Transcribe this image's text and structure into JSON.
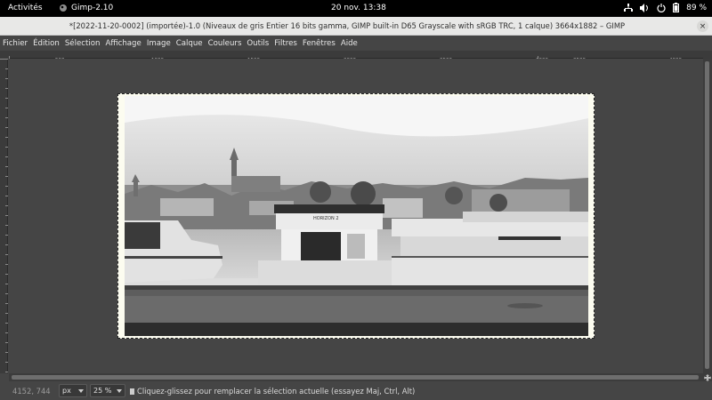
{
  "topbar": {
    "activities": "Activités",
    "app_name": "Gimp-2.10",
    "clock": "20 nov.  13:38",
    "battery": "89 %"
  },
  "window": {
    "title": "*[2022-11-20-0002] (importée)-1.0 (Niveaux de gris Entier 16 bits gamma, GIMP built-in D65 Grayscale with sRGB TRC, 1 calque) 3664x1882 – GIMP",
    "close_glyph": "×"
  },
  "menu": [
    "Fichier",
    "Édition",
    "Sélection",
    "Affichage",
    "Image",
    "Calque",
    "Couleurs",
    "Outils",
    "Filtres",
    "Fenêtres",
    "Aide"
  ],
  "ruler": {
    "labels": [
      "500",
      "1000",
      "1500",
      "2000",
      "2500",
      "3000",
      "3500",
      "4000"
    ]
  },
  "status": {
    "coords": "4152, 744",
    "unit": "px",
    "zoom": "25 %",
    "message": "Cliquez-glissez pour remplacer la sélection actuelle (essayez Maj, Ctrl, Alt)"
  },
  "photo_sign": "HORIZON 2",
  "colors": {
    "desktop_bar": "#000000",
    "canvas_bg": "#454545",
    "image_border": "#fcfcf0"
  }
}
